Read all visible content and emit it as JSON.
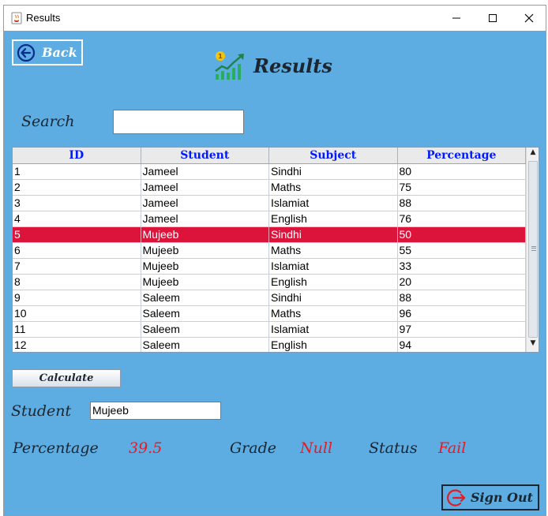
{
  "window": {
    "title": "Results",
    "icon": "java-cup-icon"
  },
  "header": {
    "back_label": "Back",
    "title": "Results",
    "icon": "growth-chart-icon"
  },
  "search": {
    "label": "Search",
    "value": "",
    "placeholder": ""
  },
  "table": {
    "columns": [
      "ID",
      "Student",
      "Subject",
      "Percentage"
    ],
    "rows": [
      [
        "1",
        "Jameel",
        "Sindhi",
        "80"
      ],
      [
        "2",
        "Jameel",
        "Maths",
        "75"
      ],
      [
        "3",
        "Jameel",
        "Islamiat",
        "88"
      ],
      [
        "4",
        "Jameel",
        "English",
        "76"
      ],
      [
        "5",
        "Mujeeb",
        "Sindhi",
        "50"
      ],
      [
        "6",
        "Mujeeb",
        "Maths",
        "55"
      ],
      [
        "7",
        "Mujeeb",
        "Islamiat",
        "33"
      ],
      [
        "8",
        "Mujeeb",
        "English",
        "20"
      ],
      [
        "9",
        "Saleem",
        "Sindhi",
        "88"
      ],
      [
        "10",
        "Saleem",
        "Maths",
        "96"
      ],
      [
        "11",
        "Saleem",
        "Islamiat",
        "97"
      ],
      [
        "12",
        "Saleem",
        "English",
        "94"
      ]
    ],
    "selected_row_index": 4
  },
  "calculate": {
    "label": "Calculate"
  },
  "student": {
    "label": "Student",
    "value": "Mujeeb"
  },
  "stats": {
    "percentage_label": "Percentage",
    "percentage_value": "39.5",
    "grade_label": "Grade",
    "grade_value": "Null",
    "status_label": "Status",
    "status_value": "Fail"
  },
  "signout": {
    "label": "Sign Out"
  },
  "colors": {
    "background": "#5dade2",
    "selected_row": "#dc143c",
    "header_text": "#0019ff",
    "value_text": "#e31b23"
  }
}
